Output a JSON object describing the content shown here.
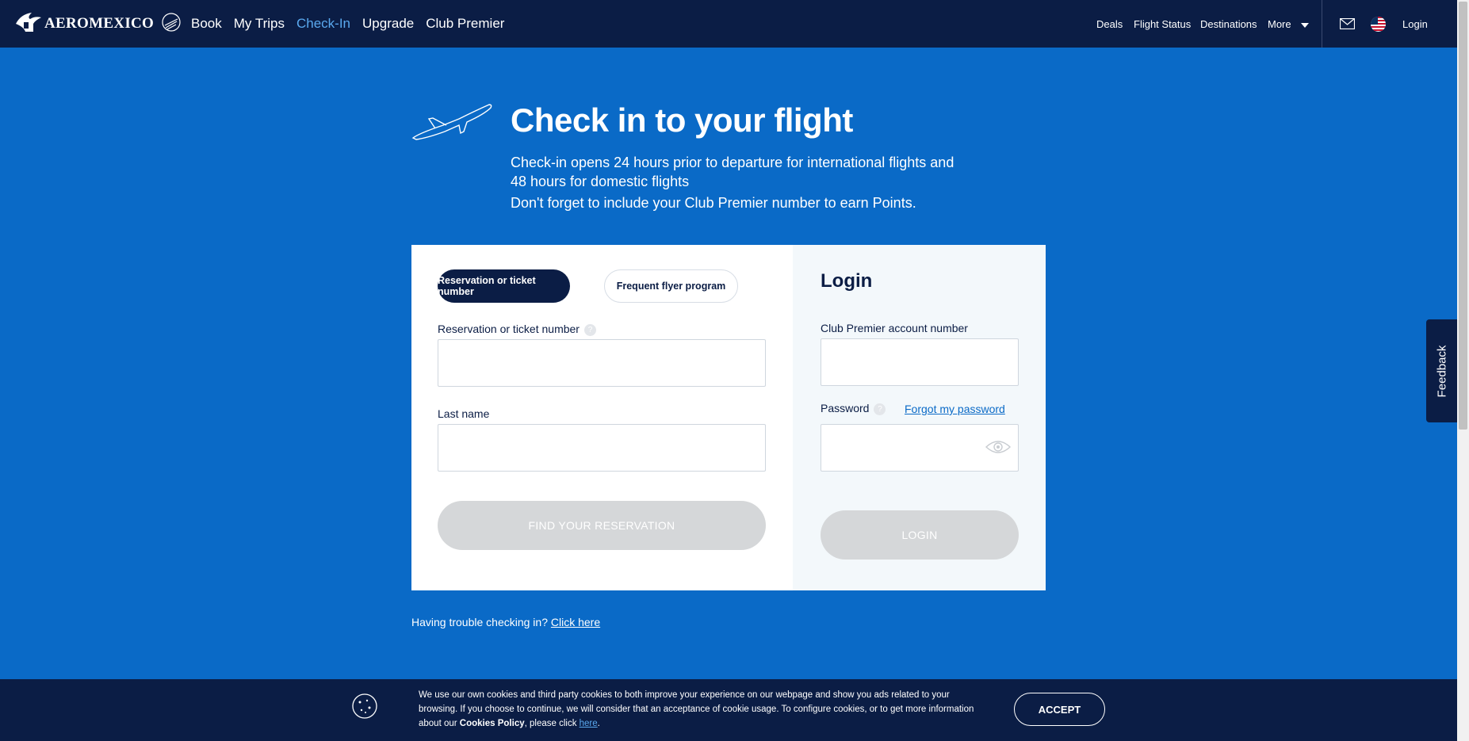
{
  "header": {
    "logo_text": "AEROMEXICO",
    "main_nav": [
      "Book",
      "My Trips",
      "Check-In",
      "Upgrade",
      "Club Premier"
    ],
    "active_nav": "Check-In",
    "secondary_nav": {
      "deals": "Deals",
      "flight_status": "Flight Status",
      "destinations": "Destinations",
      "more": "More",
      "login": "Login"
    }
  },
  "hero": {
    "title": "Check in to your flight",
    "line1": "Check-in opens 24 hours prior to departure for international flights and 48 hours for domestic flights",
    "line2": "Don't forget to include your Club Premier number to earn Points."
  },
  "checkin_form": {
    "tab_active": "Reservation or ticket number",
    "tab_inactive": "Frequent flyer program",
    "reservation_label": "Reservation or ticket number",
    "reservation_value": "",
    "lastname_label": "Last name",
    "lastname_value": "",
    "submit": "FIND YOUR RESERVATION"
  },
  "login_form": {
    "title": "Login",
    "account_label": "Club Premier account number",
    "account_value": "",
    "password_label": "Password",
    "forgot": "Forgot my password",
    "password_value": "",
    "submit": "LOGIN"
  },
  "trouble": {
    "text": "Having trouble checking in?",
    "link": "Click here"
  },
  "feedback": "Feedback",
  "cookie": {
    "text_before": "We use our own cookies and third party cookies to both improve your experience on our webpage and show you ads related to your browsing. If you choose to continue, we will consider that an acceptance of cookie usage. To configure cookies, or to get more information about our ",
    "policy": "Cookies Policy",
    "text_mid": ", please click ",
    "here": "here",
    "text_end": ".",
    "accept": "ACCEPT"
  },
  "colors": {
    "navy": "#0b1d45",
    "brand_blue": "#0a6ac7",
    "active_link": "#5aa9ef",
    "disabled_button": "#d5d7d9"
  }
}
